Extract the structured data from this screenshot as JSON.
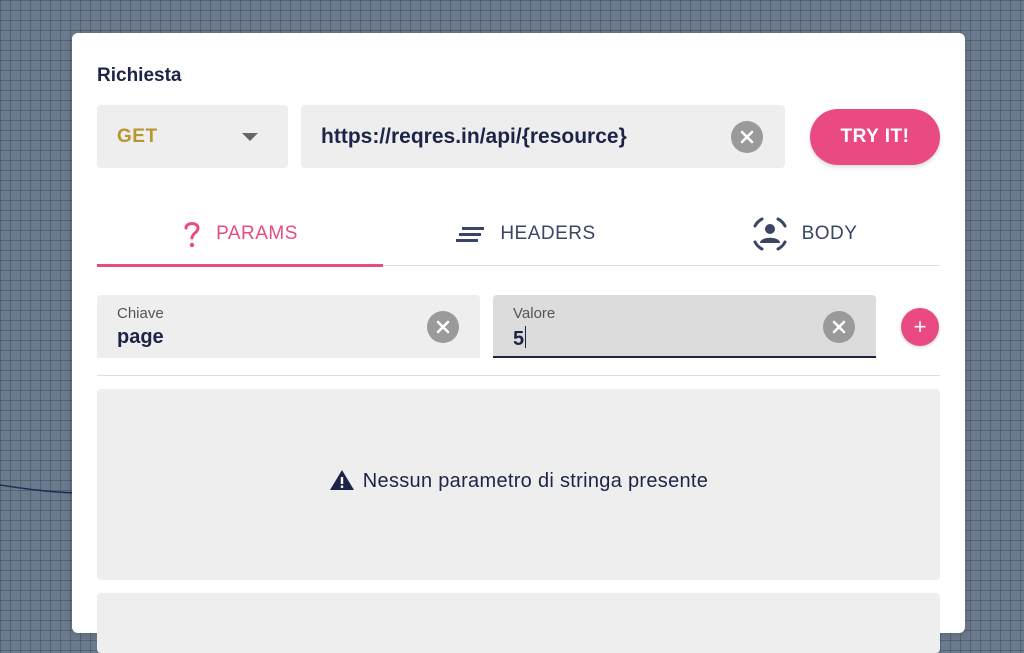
{
  "section_title": "Richiesta",
  "request": {
    "method": "GET",
    "url": "https://reqres.in/api/{resource}",
    "submit_label": "TRY IT!"
  },
  "tabs": [
    {
      "label": "PARAMS",
      "icon": "question-icon",
      "active": true
    },
    {
      "label": "HEADERS",
      "icon": "lines-icon",
      "active": false
    },
    {
      "label": "BODY",
      "icon": "user-frame-icon",
      "active": false
    }
  ],
  "param_row": {
    "key_label": "Chiave",
    "key_value": "page",
    "value_label": "Valore",
    "value_value": "5"
  },
  "empty_message": "Nessun parametro di stringa presente",
  "colors": {
    "accent": "#ea4a84",
    "text_dark": "#1c2447",
    "method": "#b8962e",
    "field_bg": "#eeeeee"
  }
}
